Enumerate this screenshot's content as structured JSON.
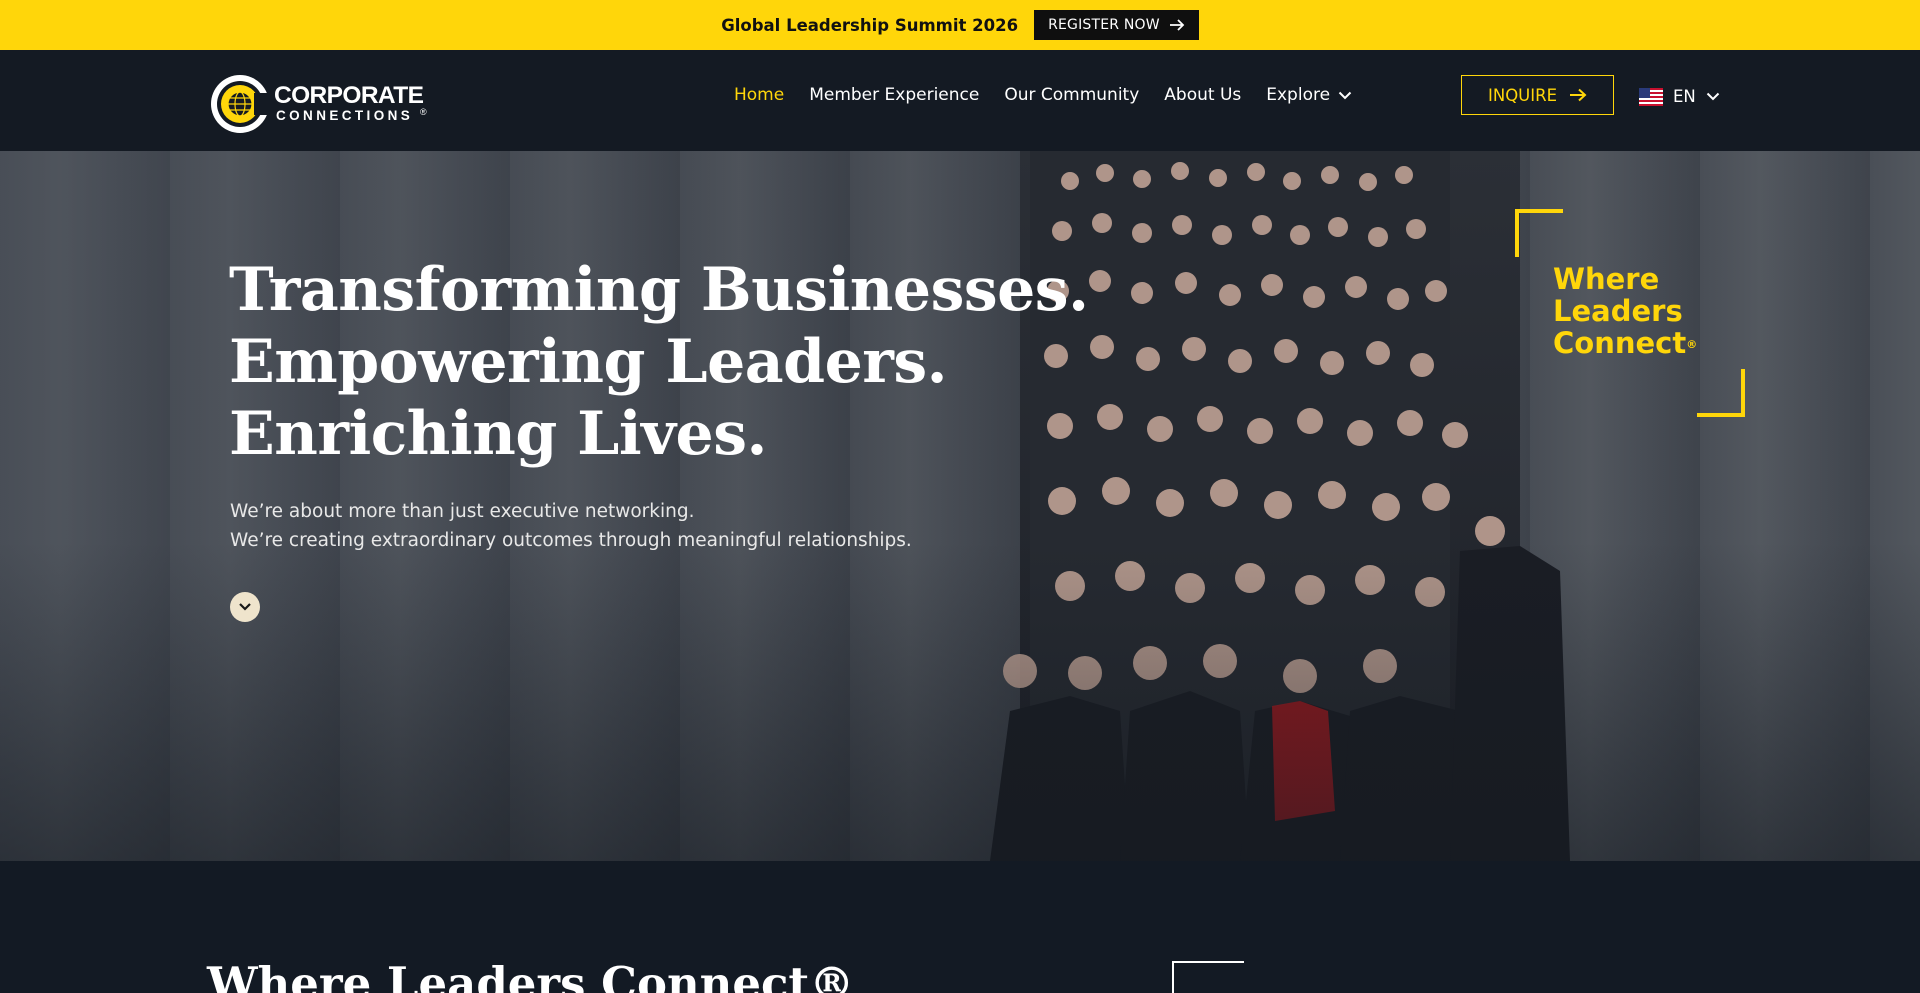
{
  "announcement": {
    "text": "Global Leadership Summit 2026",
    "button_label": "REGISTER NOW",
    "background": "#ffd60a"
  },
  "header": {
    "logo": {
      "line1": "CORPORATE",
      "line2": "CONNECTIONS",
      "reg": "®"
    },
    "nav": [
      {
        "label": "Home",
        "active": true
      },
      {
        "label": "Member Experience"
      },
      {
        "label": "Our Community"
      },
      {
        "label": "About Us"
      },
      {
        "label": "Explore",
        "has_dropdown": true
      }
    ],
    "inquire_label": "INQUIRE",
    "language": {
      "code": "EN",
      "flag_icon": "us-flag-icon"
    },
    "accent": "#ffd60a"
  },
  "hero": {
    "headline": [
      "Transforming Businesses.",
      "Empowering Leaders.",
      "Enriching Lives."
    ],
    "subcopy": [
      "We’re about more than just executive networking.",
      "We’re creating extraordinary outcomes through meaningful relationships."
    ],
    "scroll_icon": "chevron-down-icon",
    "tagline": {
      "line1": "Where",
      "line2": "Leaders",
      "line3": "Connect",
      "reg": "®"
    }
  },
  "section": {
    "title": "Where Leaders Connect®"
  }
}
